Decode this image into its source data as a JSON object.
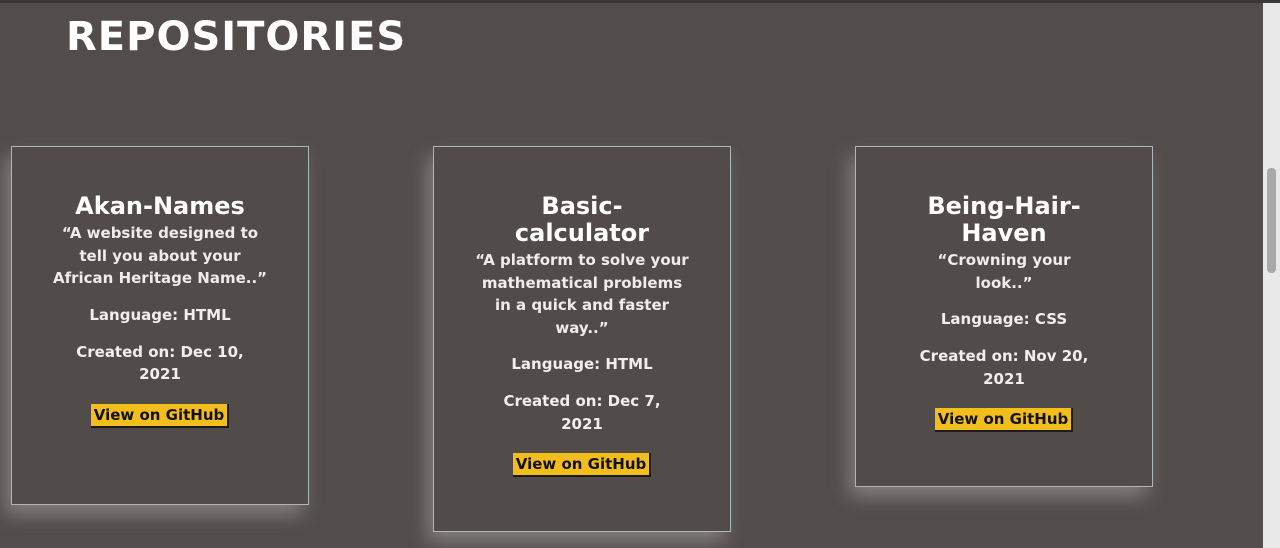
{
  "page": {
    "title": "REPOSITORIES"
  },
  "repositories": [
    {
      "name": "Akan-Names",
      "description": "“A website designed to tell you about your African Heritage Name..”",
      "language": "Language: HTML",
      "created": "Created on: Dec 10, 2021",
      "button_label": "View on GitHub"
    },
    {
      "name": "Basic-calculator",
      "description": "“A platform to solve your mathematical problems in a quick and faster way..”",
      "language": "Language: HTML",
      "created": "Created on: Dec 7, 2021",
      "button_label": "View on GitHub"
    },
    {
      "name": "Being-Hair-Haven",
      "description": "“Crowning your look..”",
      "language": "Language: CSS",
      "created": "Created on: Nov 20, 2021",
      "button_label": "View on GitHub"
    }
  ],
  "colors": {
    "background": "#524c4b",
    "button": "#f2be1b",
    "card_border": "#aeb7b7",
    "text": "#ffffff"
  }
}
